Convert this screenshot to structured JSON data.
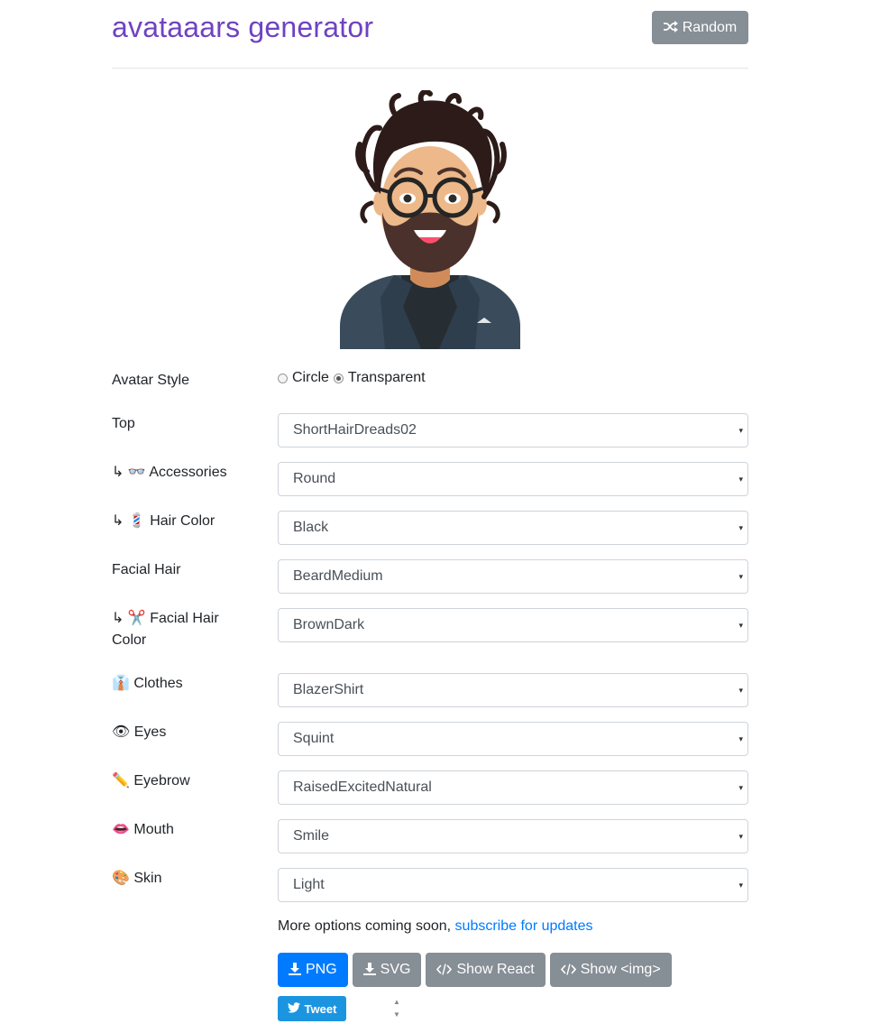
{
  "header": {
    "title": "avataaars generator",
    "random_label": "Random",
    "random_icon": "shuffle-icon"
  },
  "avatar": {
    "skin_color": "#EDB98A",
    "hair_color": "#2C1B18",
    "beard_color": "#4A312C",
    "blazer_color": "#3A4B5C",
    "shirt_color": "#262E33"
  },
  "form": {
    "avatar_style": {
      "label": "Avatar Style",
      "options": [
        "Circle",
        "Transparent"
      ],
      "selected": "Transparent"
    },
    "top": {
      "label": "Top",
      "value": "ShortHairDreads02"
    },
    "accessories": {
      "label": "↳ 👓 Accessories",
      "value": "Round"
    },
    "hair_color": {
      "label": "↳ 💈 Hair Color",
      "value": "Black"
    },
    "facial_hair": {
      "label": "Facial Hair",
      "value": "BeardMedium"
    },
    "facial_hair_color": {
      "label": "↳ ✂️ Facial Hair Color",
      "value": "BrownDark"
    },
    "clothes": {
      "label": "👔 Clothes",
      "value": "BlazerShirt"
    },
    "eyes": {
      "label": "👁 Eyes",
      "value": "Squint"
    },
    "eyebrow": {
      "label": "✏️ Eyebrow",
      "value": "RaisedExcitedNatural"
    },
    "mouth": {
      "label": "👄 Mouth",
      "value": "Smile"
    },
    "skin": {
      "label": "🎨 Skin",
      "value": "Light"
    }
  },
  "more_options": {
    "text": "More options coming soon, ",
    "link": "subscribe for updates"
  },
  "actions": {
    "png": "PNG",
    "svg": "SVG",
    "show_react": "Show React",
    "show_img": "Show <img>"
  },
  "tweet": {
    "label": "Tweet"
  },
  "caret": "▾"
}
